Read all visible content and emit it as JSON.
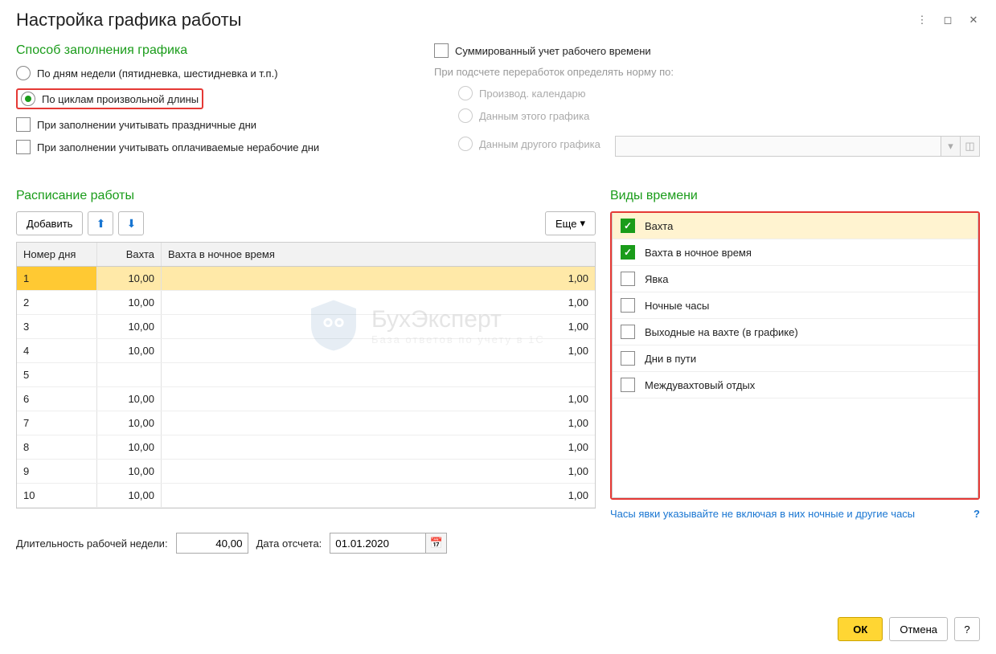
{
  "title": "Настройка графика работы",
  "fill_method": {
    "title": "Способ заполнения графика",
    "by_weekdays": "По дням недели (пятидневка, шестидневка и т.п.)",
    "by_cycles": "По циклам произвольной длины",
    "consider_holidays": "При заполнении учитывать праздничные дни",
    "consider_paid_nonwork": "При заполнении учитывать оплачиваемые нерабочие дни"
  },
  "summarized": {
    "label": "Суммированный учет рабочего времени",
    "sublabel": "При подсчете переработок определять норму по:",
    "by_calendar": "Производ. календарю",
    "by_this_schedule": "Данным этого графика",
    "by_other_schedule": "Данным другого графика"
  },
  "schedule": {
    "title": "Расписание работы",
    "add_btn": "Добавить",
    "more_btn": "Еще",
    "headers": {
      "num": "Номер дня",
      "vakhta": "Вахта",
      "night": "Вахта в ночное время"
    },
    "rows": [
      {
        "num": "1",
        "vakhta": "10,00",
        "night": "1,00",
        "selected": true
      },
      {
        "num": "2",
        "vakhta": "10,00",
        "night": "1,00"
      },
      {
        "num": "3",
        "vakhta": "10,00",
        "night": "1,00"
      },
      {
        "num": "4",
        "vakhta": "10,00",
        "night": "1,00"
      },
      {
        "num": "5",
        "vakhta": "",
        "night": ""
      },
      {
        "num": "6",
        "vakhta": "10,00",
        "night": "1,00"
      },
      {
        "num": "7",
        "vakhta": "10,00",
        "night": "1,00"
      },
      {
        "num": "8",
        "vakhta": "10,00",
        "night": "1,00"
      },
      {
        "num": "9",
        "vakhta": "10,00",
        "night": "1,00"
      },
      {
        "num": "10",
        "vakhta": "10,00",
        "night": "1,00"
      }
    ]
  },
  "time_types": {
    "title": "Виды времени",
    "items": [
      {
        "label": "Вахта",
        "checked": true,
        "hl": true
      },
      {
        "label": "Вахта в ночное время",
        "checked": true
      },
      {
        "label": "Явка",
        "checked": false
      },
      {
        "label": "Ночные часы",
        "checked": false
      },
      {
        "label": "Выходные на вахте (в графике)",
        "checked": false
      },
      {
        "label": "Дни в пути",
        "checked": false
      },
      {
        "label": "Междувахтовый отдых",
        "checked": false
      }
    ],
    "hint": "Часы явки указывайте не включая в них ночные и другие часы"
  },
  "week_length": {
    "label": "Длительность рабочей недели:",
    "value": "40,00"
  },
  "start_date": {
    "label": "Дата отсчета:",
    "value": "01.01.2020"
  },
  "footer": {
    "ok": "ОК",
    "cancel": "Отмена",
    "help": "?"
  },
  "watermark": {
    "name": "БухЭксперт",
    "sub": "База ответов по учету в 1С"
  }
}
